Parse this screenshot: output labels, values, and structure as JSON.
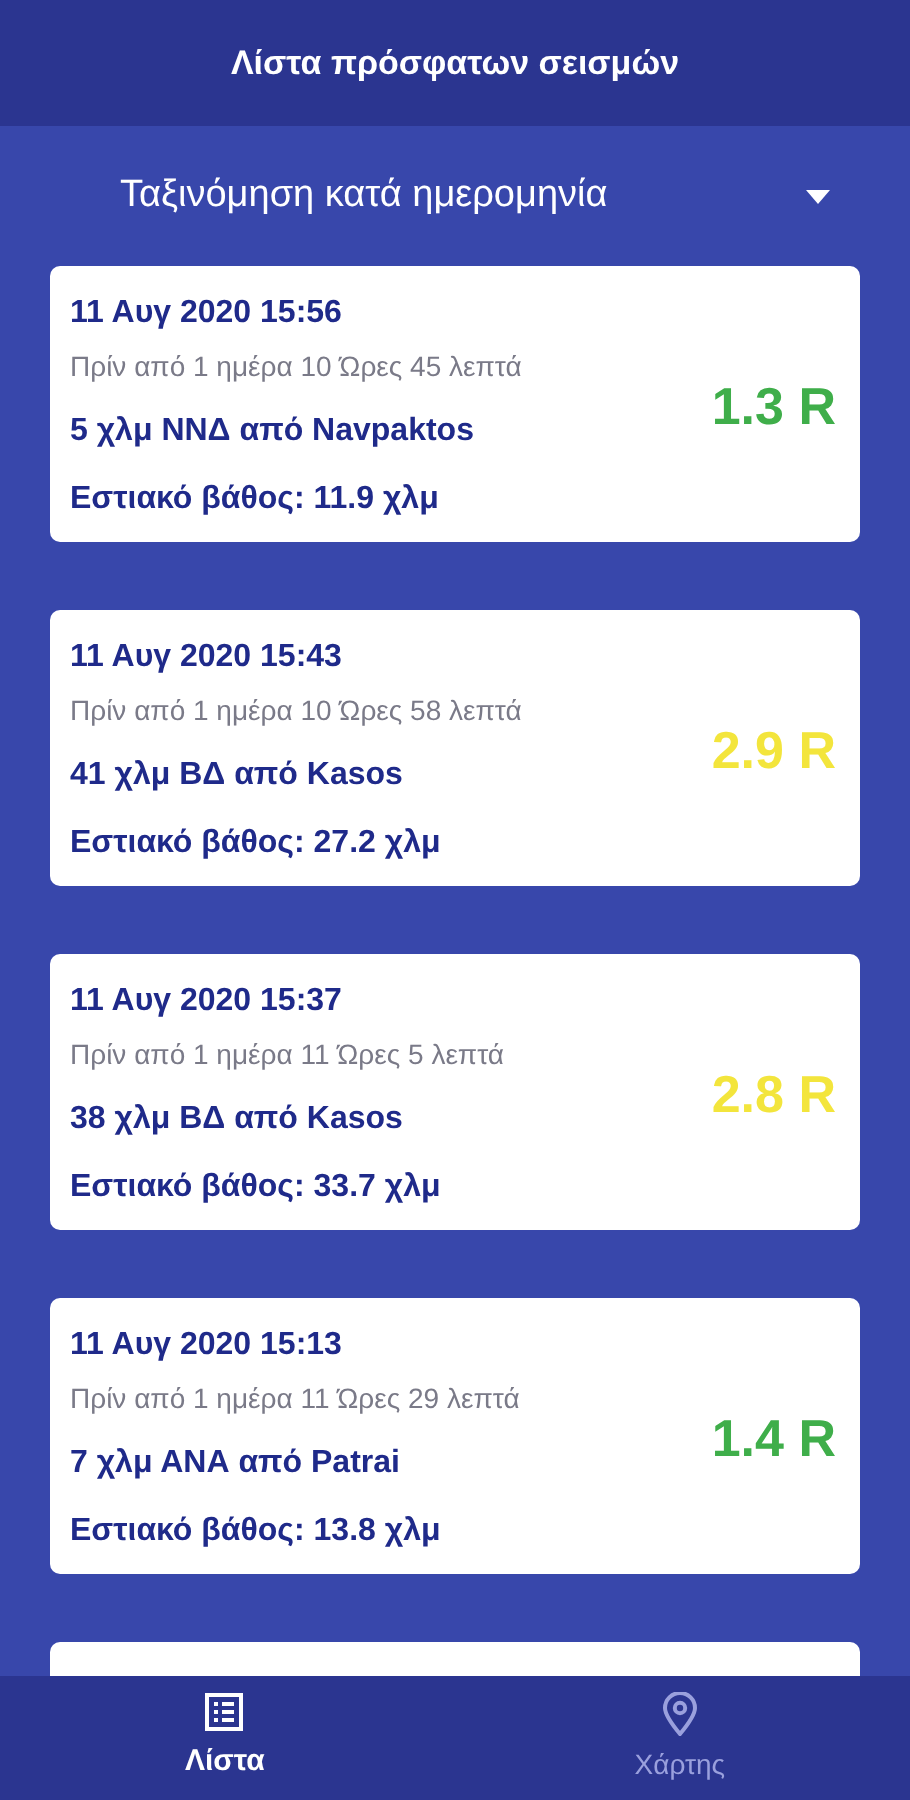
{
  "app_bar": {
    "title": "Λίστα πρόσφατων σεισμών"
  },
  "sort": {
    "label": "Ταξινόμηση κατά ημερομηνία"
  },
  "quakes": [
    {
      "date": "11 Αυγ 2020 15:56",
      "ago": "Πρίν από 1 ημέρα 10 Ώρες 45 λεπτά",
      "location": "5 χλμ ΝΝΔ από Navpaktos",
      "depth": "Εστιακό βάθος: 11.9 χλμ",
      "magnitude": "1.3 R",
      "color": "#3fae4a"
    },
    {
      "date": "11 Αυγ 2020 15:43",
      "ago": "Πρίν από 1 ημέρα 10 Ώρες 58 λεπτά",
      "location": "41 χλμ ΒΔ από Kasos",
      "depth": "Εστιακό βάθος: 27.2 χλμ",
      "magnitude": "2.9 R",
      "color": "#f3e53c"
    },
    {
      "date": "11 Αυγ 2020 15:37",
      "ago": "Πρίν από 1 ημέρα 11 Ώρες 5 λεπτά",
      "location": "38 χλμ ΒΔ από Kasos",
      "depth": "Εστιακό βάθος: 33.7 χλμ",
      "magnitude": "2.8 R",
      "color": "#f3e53c"
    },
    {
      "date": "11 Αυγ 2020 15:13",
      "ago": "Πρίν από 1 ημέρα 11 Ώρες 29 λεπτά",
      "location": "7 χλμ ΑΝΑ από Patrai",
      "depth": "Εστιακό βάθος: 13.8 χλμ",
      "magnitude": "1.4 R",
      "color": "#3fae4a"
    }
  ],
  "bottom_nav": [
    {
      "label": "Λίστα",
      "kind": "list",
      "selected": true
    },
    {
      "label": "Χάρτης",
      "kind": "map",
      "selected": false
    }
  ]
}
